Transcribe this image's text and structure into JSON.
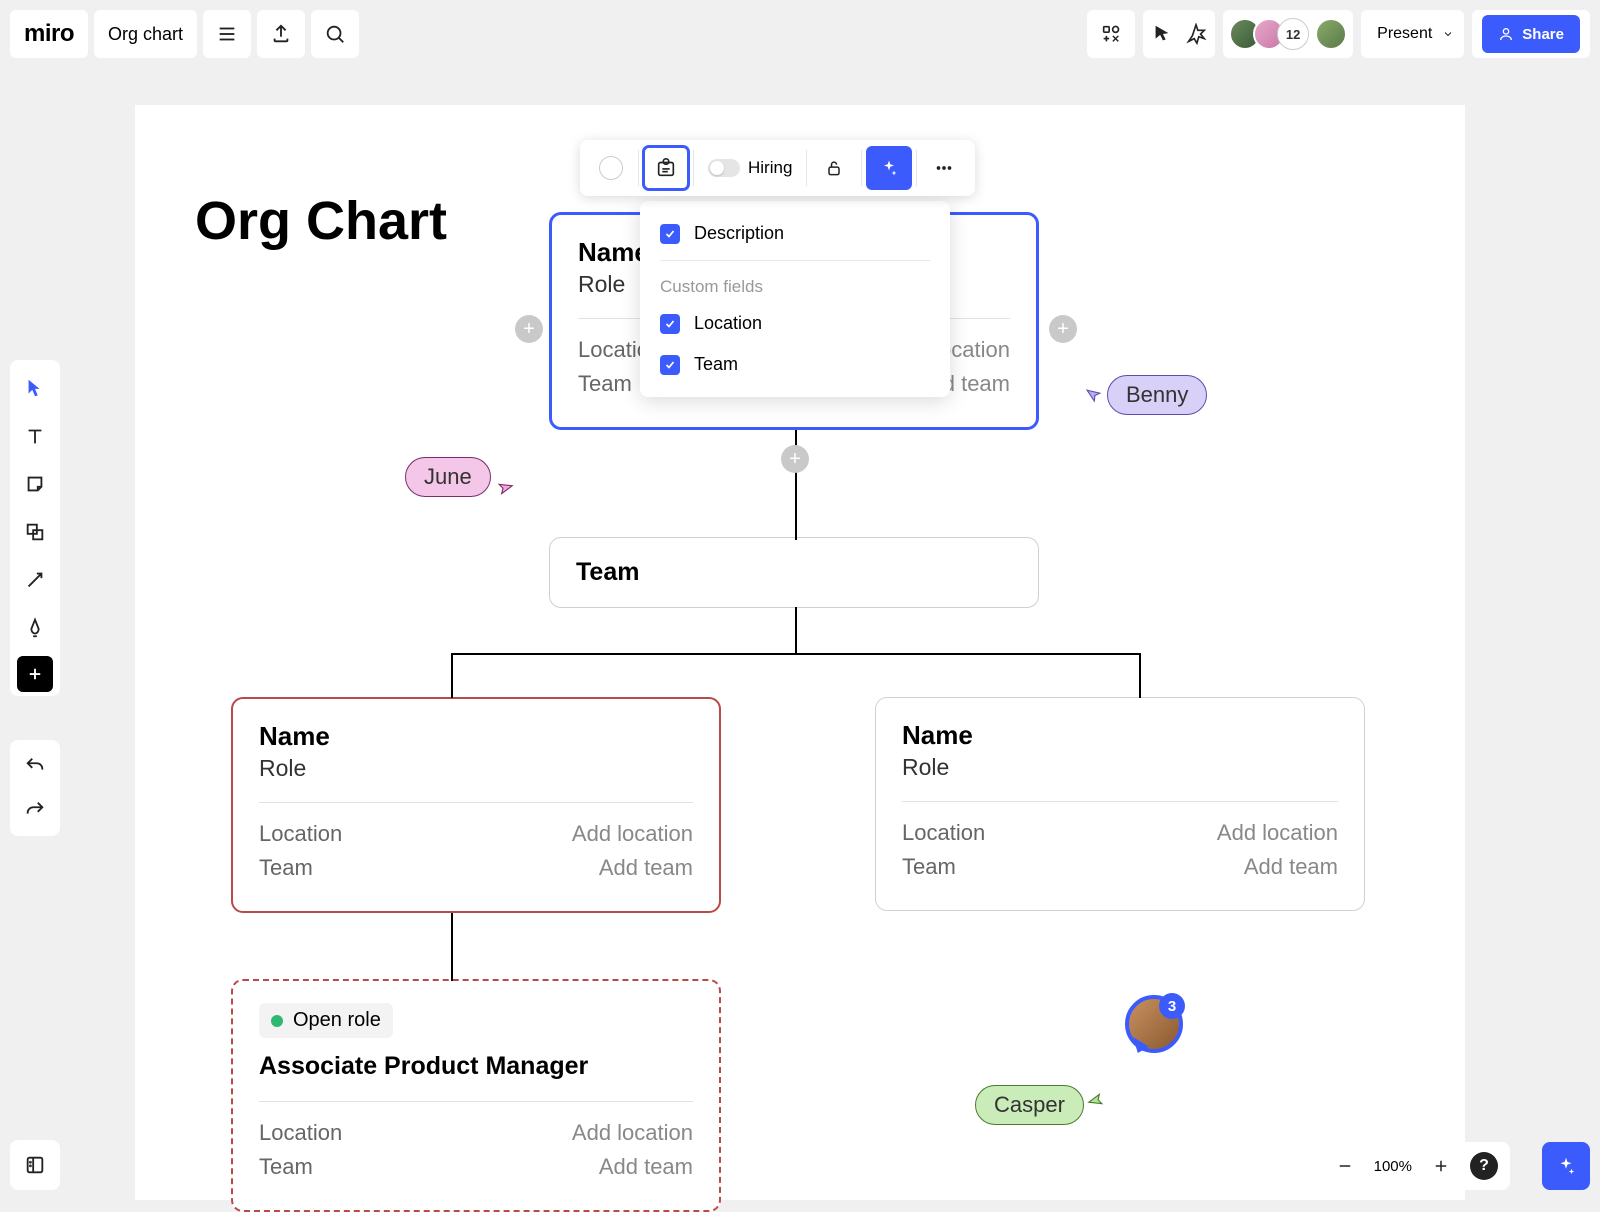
{
  "app": {
    "logo": "miro",
    "board_title": "Org chart"
  },
  "topbar": {
    "present": "Present",
    "share": "Share",
    "avatar_count": "12"
  },
  "canvas": {
    "title": "Org Chart"
  },
  "card_toolbar": {
    "hiring_label": "Hiring"
  },
  "dropdown": {
    "description": "Description",
    "custom_fields_header": "Custom fields",
    "location": "Location",
    "team": "Team"
  },
  "cards": {
    "root": {
      "name": "Name",
      "role": "Role",
      "location_label": "Location",
      "location_hint_suffix": "ocation",
      "team_label": "Team",
      "team_hint_suffix": "d team"
    },
    "team_node": {
      "title": "Team"
    },
    "left": {
      "name": "Name",
      "role": "Role",
      "location_label": "Location",
      "location_hint": "Add location",
      "team_label": "Team",
      "team_hint": "Add team"
    },
    "right": {
      "name": "Name",
      "role": "Role",
      "location_label": "Location",
      "location_hint": "Add location",
      "team_label": "Team",
      "team_hint": "Add team"
    },
    "open": {
      "badge": "Open role",
      "title": "Associate Product Manager",
      "location_label": "Location",
      "location_hint": "Add location",
      "team_label": "Team",
      "team_hint": "Add team"
    }
  },
  "cursors": {
    "june": "June",
    "benny": "Benny",
    "casper": "Casper"
  },
  "video": {
    "badge": "3"
  },
  "zoom": {
    "level": "100%"
  }
}
